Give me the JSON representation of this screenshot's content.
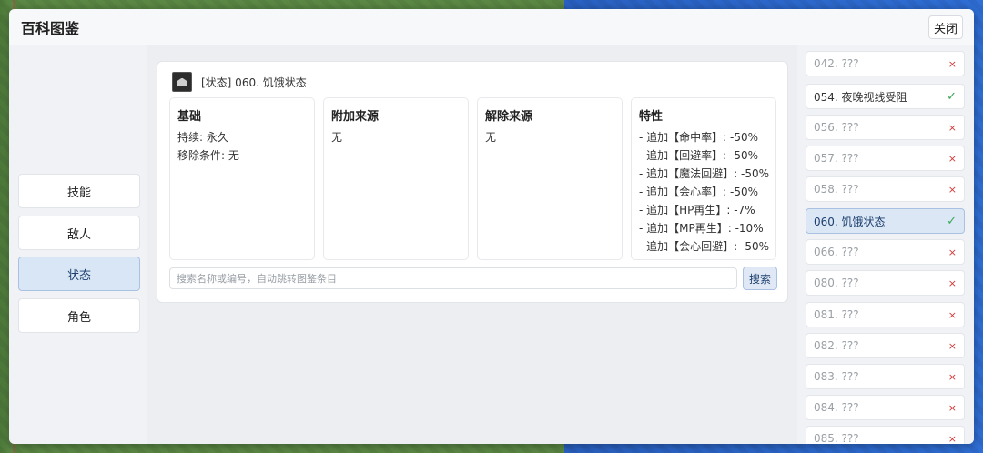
{
  "window": {
    "title": "百科图鉴",
    "close_label": "关闭"
  },
  "nav": {
    "items": [
      {
        "label": "技能"
      },
      {
        "label": "敌人"
      },
      {
        "label": "状态",
        "active": true
      },
      {
        "label": "角色"
      }
    ]
  },
  "detail": {
    "icon": "state-icon",
    "title": "[状态] 060. 饥饿状态",
    "columns": [
      {
        "heading": "基础",
        "lines": [
          "持续: 永久",
          "移除条件: 无"
        ]
      },
      {
        "heading": "附加来源",
        "lines": [
          "无"
        ]
      },
      {
        "heading": "解除来源",
        "lines": [
          "无"
        ]
      },
      {
        "heading": "特性",
        "lines": [
          "- 追加【命中率】: -50%",
          "- 追加【回避率】: -50%",
          "- 追加【魔法回避】: -50%",
          "- 追加【会心率】: -50%",
          "- 追加【HP再生】: -7%",
          "- 追加【MP再生】: -10%",
          "- 追加【会心回避】: -50%"
        ]
      }
    ]
  },
  "search": {
    "placeholder": "搜索名称或编号，自动跳转图鉴条目",
    "button_label": "搜索"
  },
  "list": {
    "items": [
      {
        "label": "042. ???",
        "status": "×",
        "known": false
      },
      {
        "label": "054. 夜晚视线受阻",
        "status": "✓",
        "known": true
      },
      {
        "label": "056. ???",
        "status": "×",
        "known": false
      },
      {
        "label": "057. ???",
        "status": "×",
        "known": false
      },
      {
        "label": "058. ???",
        "status": "×",
        "known": false
      },
      {
        "label": "060. 饥饿状态",
        "status": "✓",
        "known": true,
        "active": true
      },
      {
        "label": "066. ???",
        "status": "×",
        "known": false
      },
      {
        "label": "080. ???",
        "status": "×",
        "known": false
      },
      {
        "label": "081. ???",
        "status": "×",
        "known": false
      },
      {
        "label": "082. ???",
        "status": "×",
        "known": false
      },
      {
        "label": "083. ???",
        "status": "×",
        "known": false
      },
      {
        "label": "084. ???",
        "status": "×",
        "known": false
      },
      {
        "label": "085. ???",
        "status": "×",
        "known": false
      }
    ]
  },
  "colors": {
    "accent": "#d9e6f5",
    "accent_border": "#a9c2e2",
    "ok": "#3aa755",
    "missing": "#d33b3b"
  }
}
